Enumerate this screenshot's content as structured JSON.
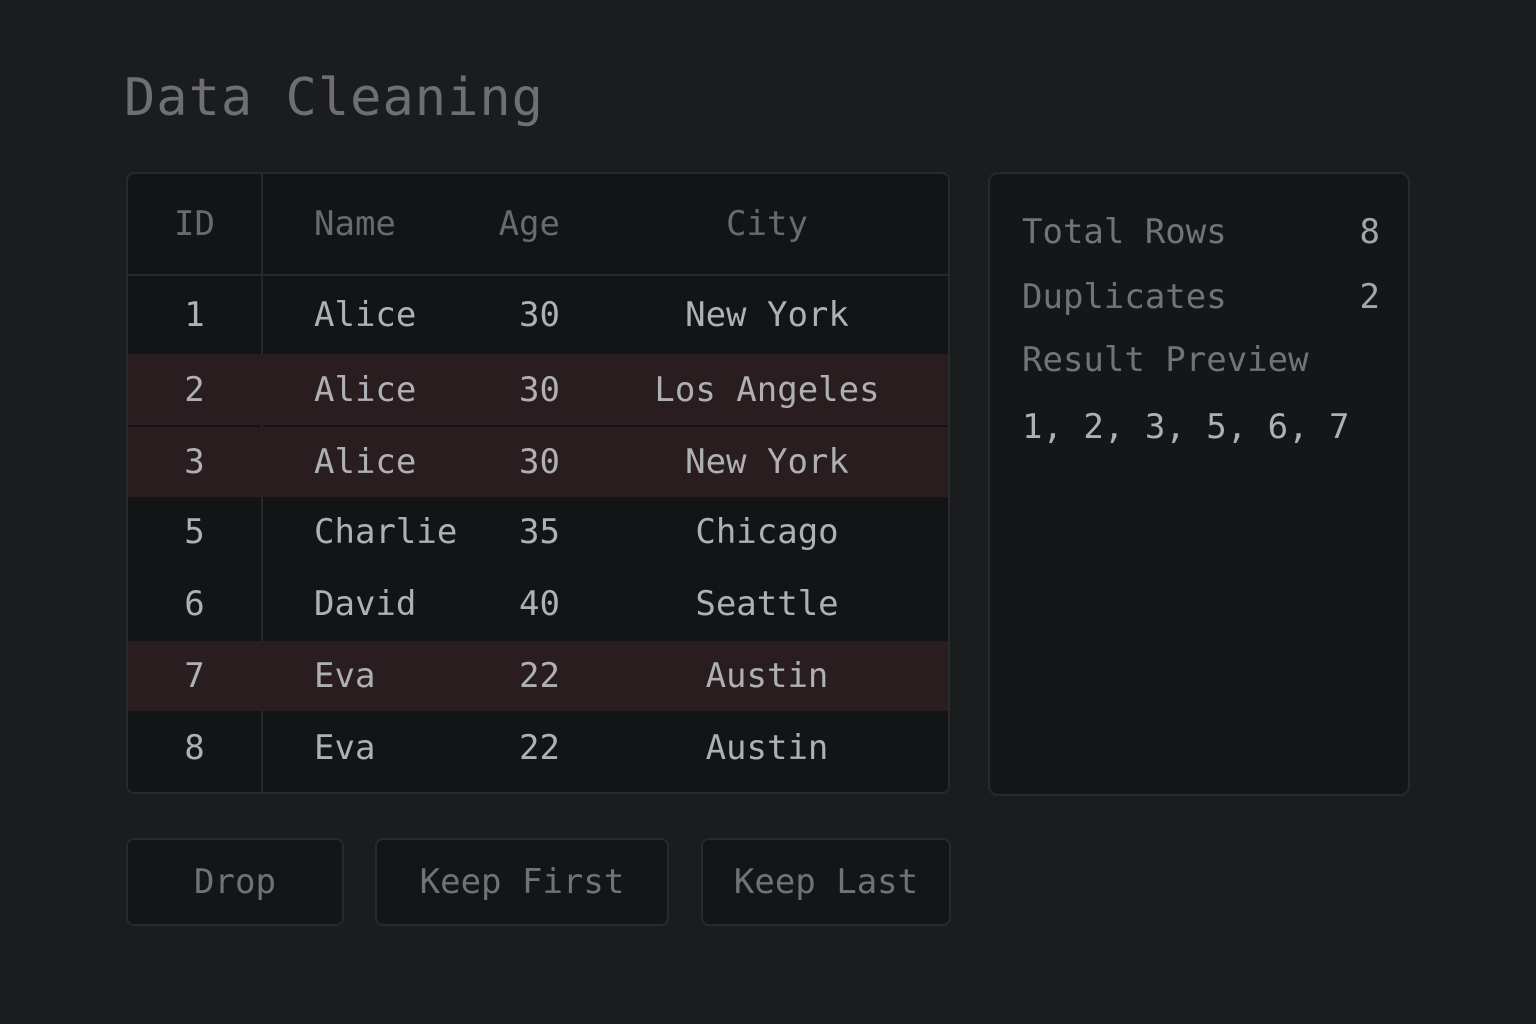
{
  "page": {
    "title": "Data Cleaning"
  },
  "table": {
    "columns": [
      "ID",
      "Name",
      "Age",
      "City"
    ],
    "rows": [
      {
        "id": "1",
        "name": "Alice",
        "age": "30",
        "city": "New York",
        "duplicate": false
      },
      {
        "id": "2",
        "name": "Alice",
        "age": "30",
        "city": "Los Angeles",
        "duplicate": true
      },
      {
        "id": "3",
        "name": "Alice",
        "age": "30",
        "city": "New York",
        "duplicate": true
      },
      {
        "id": "5",
        "name": "Charlie",
        "age": "35",
        "city": "Chicago",
        "duplicate": false
      },
      {
        "id": "6",
        "name": "David",
        "age": "40",
        "city": "Seattle",
        "duplicate": false
      },
      {
        "id": "7",
        "name": "Eva",
        "age": "22",
        "city": "Austin",
        "duplicate": true
      },
      {
        "id": "8",
        "name": "Eva",
        "age": "22",
        "city": "Austin",
        "duplicate": false
      }
    ]
  },
  "summary": {
    "total_rows_label": "Total Rows",
    "total_rows_value": "8",
    "duplicates_label": "Duplicates",
    "duplicates_value": "2",
    "preview_label": "Result Preview",
    "preview_value": "1, 2, 3, 5, 6, 7"
  },
  "actions": {
    "drop_label": "Drop",
    "keep_first_label": "Keep First",
    "keep_last_label": "Keep Last"
  },
  "colors": {
    "background": "#1b1c1e",
    "panel": "#131416",
    "duplicate_highlight": "#2a1d1f",
    "border": "#27292c"
  }
}
